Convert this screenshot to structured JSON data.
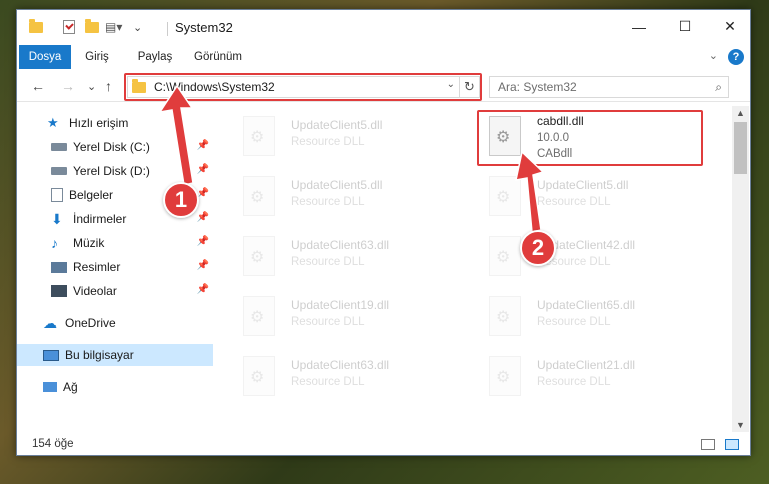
{
  "window": {
    "title": "System32",
    "buttons": {
      "minimize": "—",
      "maximize": "☐",
      "close": "✕"
    }
  },
  "ribbon": {
    "tabs": [
      "Dosya",
      "Giriş",
      "Paylaş",
      "Görünüm"
    ],
    "help": "?"
  },
  "navigation": {
    "back": "←",
    "forward": "→",
    "recent": "⌄",
    "up": "↑",
    "address": "C:\\Windows\\System32",
    "dropdown": "⌄",
    "refresh": "↻",
    "search_placeholder": "Ara: System32",
    "search_icon": "⌕"
  },
  "sidebar": {
    "items": [
      {
        "label": "Hızlı erişim",
        "icon": "star-icon",
        "pinned": false
      },
      {
        "label": "Yerel Disk (C:)",
        "icon": "drive-icon",
        "pinned": true
      },
      {
        "label": "Yerel Disk (D:)",
        "icon": "drive-icon",
        "pinned": true
      },
      {
        "label": "Belgeler",
        "icon": "documents-icon",
        "pinned": true
      },
      {
        "label": "İndirmeler",
        "icon": "download-icon",
        "pinned": true
      },
      {
        "label": "Müzik",
        "icon": "music-icon",
        "pinned": true
      },
      {
        "label": "Resimler",
        "icon": "pictures-icon",
        "pinned": true
      },
      {
        "label": "Videolar",
        "icon": "videos-icon",
        "pinned": true
      },
      {
        "label": "OneDrive",
        "icon": "cloud-icon",
        "pinned": false
      },
      {
        "label": "Bu bilgisayar",
        "icon": "computer-icon",
        "pinned": false,
        "selected": true
      },
      {
        "label": "Ağ",
        "icon": "network-icon",
        "pinned": false
      }
    ]
  },
  "files": [
    {
      "name": "UpdateClient5.dll",
      "desc": "Resource DLL"
    },
    {
      "name": "cabdll.dll",
      "version": "10.0.0",
      "desc": "CABdll",
      "highlighted": true
    },
    {
      "name": "UpdateClient5.dll",
      "desc": "Resource DLL"
    },
    {
      "name": "UpdateClient5.dll",
      "desc": "Resource DLL"
    },
    {
      "name": "UpdateClient63.dll",
      "desc": "Resource DLL"
    },
    {
      "name": "UpdateClient42.dll",
      "desc": "Resource DLL"
    },
    {
      "name": "UpdateClient19.dll",
      "desc": "Resource DLL"
    },
    {
      "name": "UpdateClient65.dll",
      "desc": "Resource DLL"
    },
    {
      "name": "UpdateClient63.dll",
      "desc": "Resource DLL"
    },
    {
      "name": "UpdateClient21.dll",
      "desc": "Resource DLL"
    }
  ],
  "status": {
    "item_count": "154 öğe"
  },
  "annotations": {
    "badge1": "1",
    "badge2": "2",
    "color": "#e03c3c"
  },
  "colors": {
    "accent": "#1979ca",
    "selection": "#cce8ff"
  }
}
